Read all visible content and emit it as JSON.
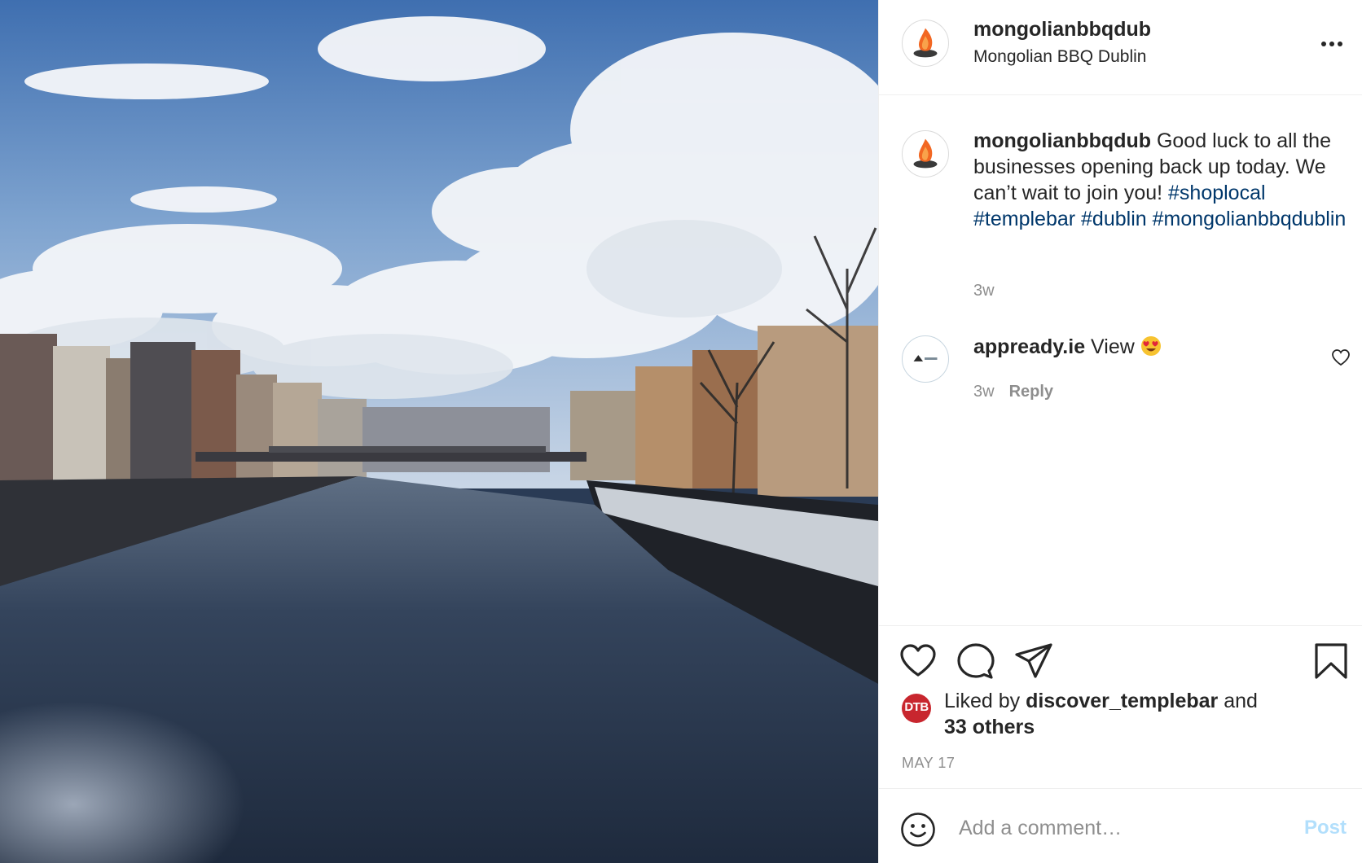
{
  "post": {
    "image_alt": "River Liffey, Dublin",
    "account": {
      "username": "mongolianbbqdub",
      "location": "Mongolian BBQ Dublin"
    },
    "caption": {
      "username": "mongolianbbqdub",
      "text": " Good luck to all the businesses opening back up today. We can’t wait to join you! ",
      "hashtags": [
        "#shoplocal",
        "#templebar",
        "#dublin",
        "#mongolianbbqdublin"
      ],
      "time": "3w"
    },
    "comments": [
      {
        "username": "appready.ie",
        "text": " View",
        "emoji": "heart-eyes",
        "time": "3w",
        "reply_label": "Reply"
      }
    ],
    "likes": {
      "avatar_text": "DTB",
      "prefix": "Liked by ",
      "user": "discover_templebar",
      "middle": " and",
      "others": "33 others"
    },
    "date": "MAY 17",
    "add_comment": {
      "placeholder": "Add a comment…",
      "post_label": "Post"
    }
  },
  "colors": {
    "hashtag": "#00376b",
    "muted": "#8e8e8e",
    "post_button_disabled": "#b2dffc",
    "flame": "#f26722"
  },
  "icons": [
    "more-options-icon",
    "heart-icon",
    "comment-icon",
    "share-icon",
    "bookmark-icon",
    "smiley-icon"
  ]
}
